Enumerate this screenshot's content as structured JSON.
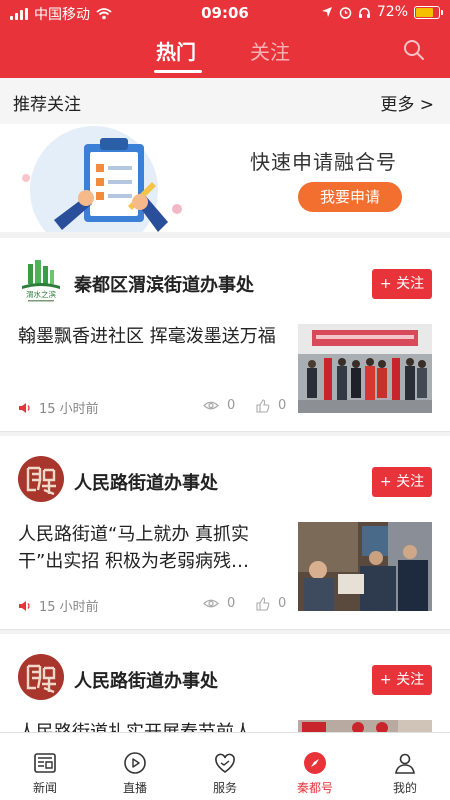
{
  "status_bar": {
    "carrier": "中国移动",
    "time": "09:06",
    "battery": "72%"
  },
  "top_tabs": [
    {
      "label": "热门",
      "active": true
    },
    {
      "label": "关注",
      "active": false
    }
  ],
  "recommend": {
    "title": "推荐关注",
    "more": "更多 >"
  },
  "banner": {
    "title": "快速申请融合号",
    "button": "我要申请"
  },
  "cards": [
    {
      "account": "秦都区渭滨街道办事处",
      "logo_text": "渭水之滨",
      "follow": "+ 关注",
      "title": "翰墨飘香进社区  挥毫泼墨送万福",
      "time": "15 小时前",
      "views": "0",
      "likes": "0"
    },
    {
      "account": "人民路街道办事处",
      "follow": "+ 关注",
      "title": "人民路街道“马上就办 真抓实干”出实招 积极为老弱病残…",
      "time": "15 小时前",
      "views": "0",
      "likes": "0"
    },
    {
      "account": "人民路街道办事处",
      "follow": "+ 关注",
      "title": "人民路街道扎实开展春节前人",
      "time": "",
      "views": "",
      "likes": ""
    }
  ],
  "tabbar": [
    {
      "label": "新闻",
      "icon": "news-icon"
    },
    {
      "label": "直播",
      "icon": "play-icon"
    },
    {
      "label": "服务",
      "icon": "service-icon"
    },
    {
      "label": "秦都号",
      "icon": "compass-icon",
      "active": true
    },
    {
      "label": "我的",
      "icon": "person-icon"
    }
  ],
  "colors": {
    "brand_red": "#e8333a",
    "apply_orange": "#f36f2f"
  }
}
